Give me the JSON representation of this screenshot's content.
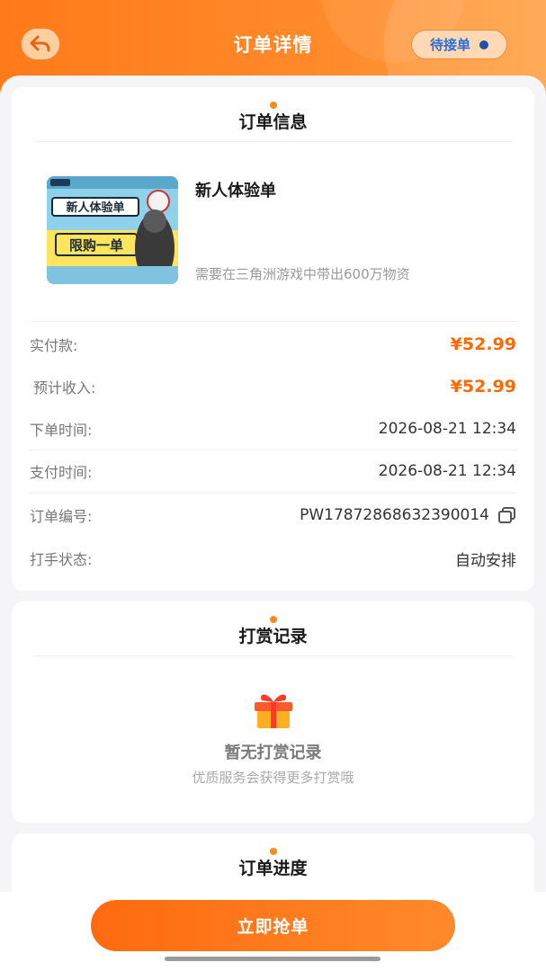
{
  "header": {
    "title": "订单详情",
    "status": "待接单",
    "accent": "#ff7a1a"
  },
  "order_info": {
    "title": "订单信息",
    "product": {
      "name": "新人体验单",
      "description": "需要在三角洲游戏中带出600万物资",
      "thumb_line1": "新人体验单",
      "thumb_line2": "限购一单"
    },
    "rows": [
      {
        "label": "实付款:",
        "value": "¥52.99"
      },
      {
        "label": "预计收入:",
        "value": "¥52.99"
      },
      {
        "label": "下单时间:",
        "value": "2026-08-21 12:34"
      },
      {
        "label": "支付时间:",
        "value": "2026-08-21 12:34"
      },
      {
        "label": "订单编号:",
        "value": "PW17872868632390014"
      },
      {
        "label": "打手状态:",
        "value": "自动安排"
      }
    ]
  },
  "reward": {
    "title": "打赏记录",
    "empty_title": "暂无打赏记录",
    "empty_subtitle": "优质服务会获得更多打赏哦"
  },
  "progress": {
    "title": "订单进度"
  },
  "action": {
    "grab_label": "立即抢单"
  },
  "colors": {
    "price": "#ff6a00",
    "status_text": "#2a6fd6"
  }
}
